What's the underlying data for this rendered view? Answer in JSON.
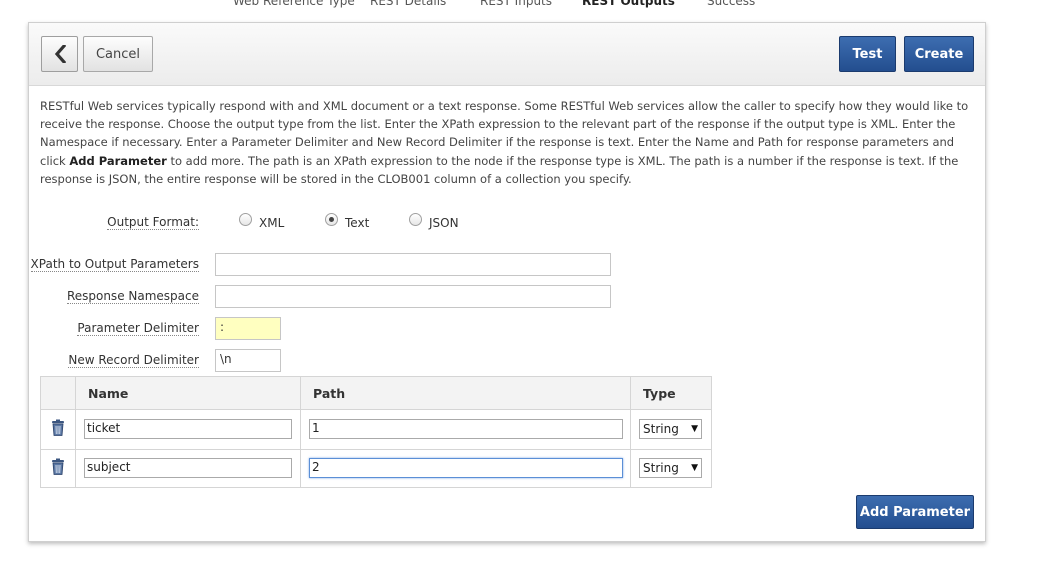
{
  "wizard_steps": [
    {
      "label": "Web Reference Type",
      "active": false
    },
    {
      "label": "REST Details",
      "active": false
    },
    {
      "label": "REST Inputs",
      "active": false
    },
    {
      "label": "REST Outputs",
      "active": true
    },
    {
      "label": "Success",
      "active": false
    }
  ],
  "toolbar": {
    "back_icon": "chevron-left-icon",
    "cancel_label": "Cancel",
    "test_label": "Test",
    "create_label": "Create"
  },
  "description": {
    "part1": "RESTful Web services typically respond with and XML document or a text response. Some RESTful Web services allow the caller to specify how they would like to receive the response. Choose the output type from the list. Enter the XPath expression to the relevant part of the response if the output type is XML. Enter the Namespace if necessary. Enter a Parameter Delimiter and New Record Delimiter if the response is text. Enter the Name and Path for response parameters and click ",
    "bold": "Add Parameter",
    "part2": " to add more. The path is an XPath expression to the node if the response type is XML. The path is a number if the response is text. If the response is JSON, the entire response will be stored in the CLOB001 column of a collection you specify."
  },
  "form": {
    "output_format_label": "Output Format:",
    "output_format_options": [
      "XML",
      "Text",
      "JSON"
    ],
    "output_format_selected": "Text",
    "xpath_label": "XPath to Output Parameters",
    "xpath_value": "",
    "namespace_label": "Response Namespace",
    "namespace_value": "",
    "param_delim_label": "Parameter Delimiter",
    "param_delim_value": ":",
    "record_delim_label": "New Record Delimiter",
    "record_delim_value": "\\n"
  },
  "params_table": {
    "columns": [
      "Name",
      "Path",
      "Type"
    ],
    "rows": [
      {
        "name": "ticket",
        "path": "1",
        "type": "String"
      },
      {
        "name": "subject",
        "path": "2",
        "type": "String"
      }
    ],
    "delete_icon": "trash-icon"
  },
  "add_parameter_label": "Add Parameter",
  "colors": {
    "accent": "#2a5597",
    "highlight_input": "#ffffc0"
  }
}
